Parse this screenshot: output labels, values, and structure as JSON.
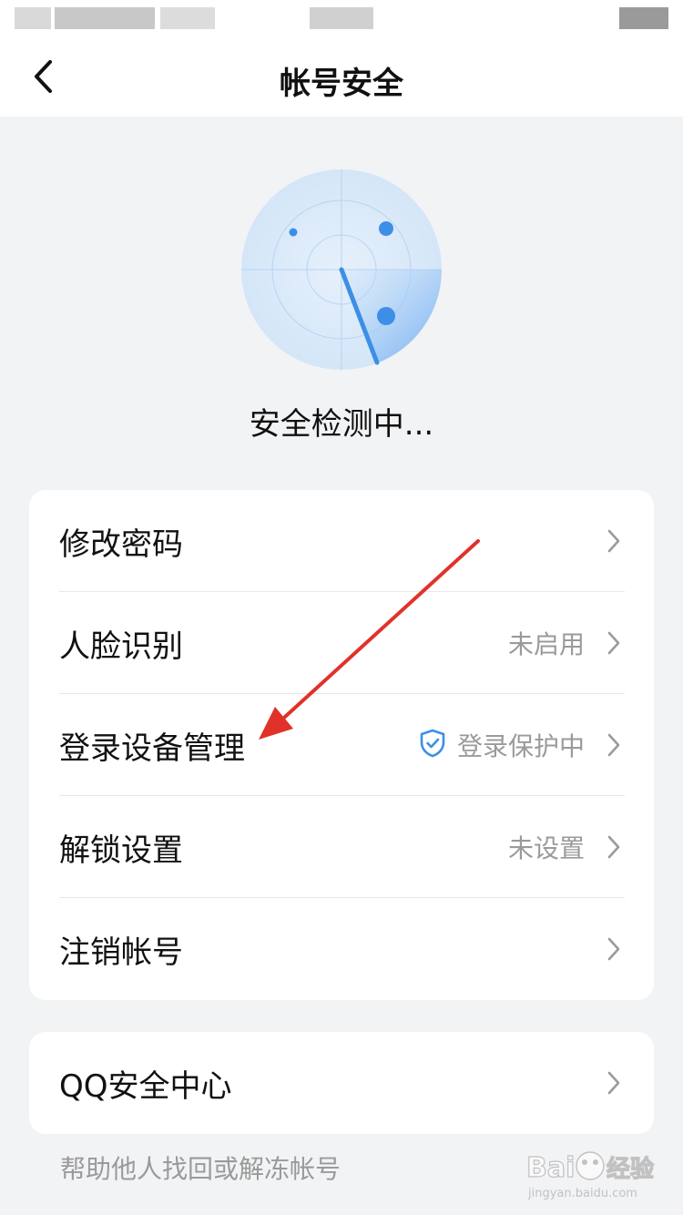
{
  "nav": {
    "title": "帐号安全"
  },
  "scan": {
    "status_text": "安全检测中..."
  },
  "settings": {
    "items": [
      {
        "label": "修改密码",
        "value": ""
      },
      {
        "label": "人脸识别",
        "value": "未启用"
      },
      {
        "label": "登录设备管理",
        "value": "登录保护中"
      },
      {
        "label": "解锁设置",
        "value": "未设置"
      },
      {
        "label": "注销帐号",
        "value": ""
      }
    ]
  },
  "qq_center": {
    "label": "QQ安全中心"
  },
  "footer": {
    "help_link": "帮助他人找回或解冻帐号"
  },
  "watermark": {
    "text": "Baidu经验",
    "subtext": "jingyan.baidu.com"
  },
  "colors": {
    "accent": "#3d8fe6",
    "annotation": "#e0322a",
    "page_bg": "#f2f3f5"
  },
  "icons": {
    "back": "chevron-left-icon",
    "chevron": "chevron-right-icon",
    "shield": "shield-check-icon"
  }
}
